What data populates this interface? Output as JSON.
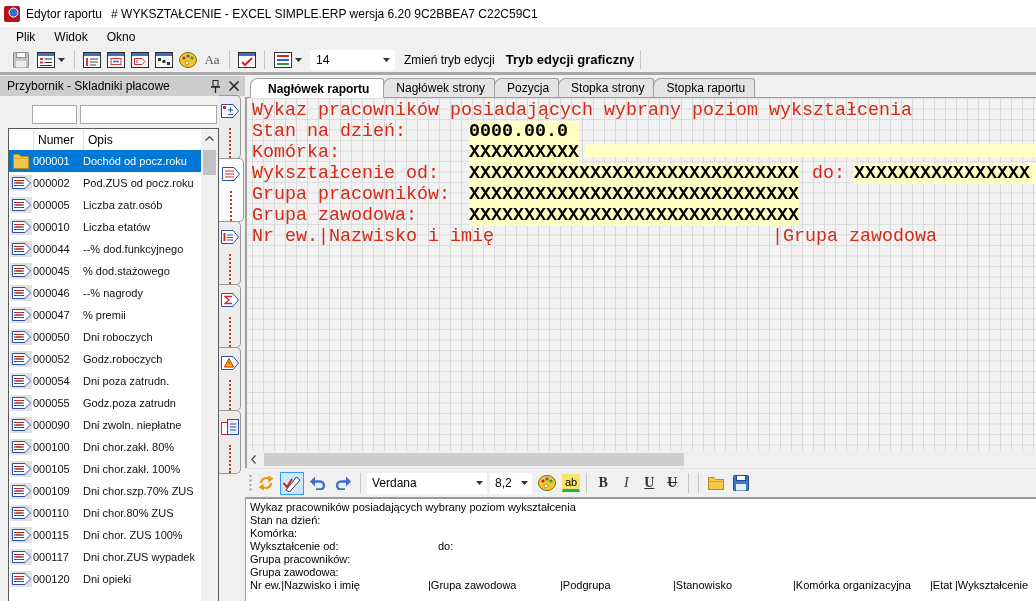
{
  "window": {
    "title": "Edytor raportu",
    "subtitle": "# WYKSZTAŁCENIE - EXCEL SIMPLE.ERP wersja 6.20 9C2BBEA7 C22C59C1"
  },
  "menu": [
    "Plik",
    "Widok",
    "Okno"
  ],
  "toolbar": {
    "save_disabled": true,
    "font_button": "Aa",
    "font_size": "14",
    "mode_button": "Zmień tryb edycji",
    "mode_label": "Tryb edycji graficzny"
  },
  "toolbox": {
    "title": "Przybornik - Skladniki płacowe",
    "columns": [
      "Numer",
      "Opis"
    ],
    "items": [
      {
        "number": "000001",
        "description": "Dochód od pocz.roku",
        "kind": "folder",
        "selected": true
      },
      {
        "number": "000002",
        "description": "Pod.ZUS od pocz.roku",
        "kind": "item",
        "selected": false
      },
      {
        "number": "000005",
        "description": "Liczba zatr.osób",
        "kind": "item",
        "selected": false
      },
      {
        "number": "000010",
        "description": "Liczba etatów",
        "kind": "item",
        "selected": false
      },
      {
        "number": "000044",
        "description": "--% dod.funkcyjnego",
        "kind": "item",
        "selected": false
      },
      {
        "number": "000045",
        "description": "% dod.stażowego",
        "kind": "item",
        "selected": false
      },
      {
        "number": "000046",
        "description": "--% nagrody",
        "kind": "item",
        "selected": false
      },
      {
        "number": "000047",
        "description": "% premii",
        "kind": "item",
        "selected": false
      },
      {
        "number": "000050",
        "description": "Dni roboczych",
        "kind": "item",
        "selected": false
      },
      {
        "number": "000052",
        "description": "Godz.roboczych",
        "kind": "item",
        "selected": false
      },
      {
        "number": "000054",
        "description": "Dni poza zatrudn.",
        "kind": "item",
        "selected": false
      },
      {
        "number": "000055",
        "description": "Godz.poza zatrudn",
        "kind": "item",
        "selected": false
      },
      {
        "number": "000090",
        "description": "Dni zwoln. niepłatne",
        "kind": "item",
        "selected": false
      },
      {
        "number": "000100",
        "description": "Dni chor.zakł. 80%",
        "kind": "item",
        "selected": false
      },
      {
        "number": "000105",
        "description": "Dni chor.zakł. 100%",
        "kind": "item",
        "selected": false
      },
      {
        "number": "000109",
        "description": "Dni chor.szp.70% ZUS",
        "kind": "item",
        "selected": false
      },
      {
        "number": "000110",
        "description": "Dni chor.80% ZUS",
        "kind": "item",
        "selected": false
      },
      {
        "number": "000115",
        "description": "Dni chor. ZUS 100%",
        "kind": "item",
        "selected": false
      },
      {
        "number": "000117",
        "description": "Dni chor.ZUS wypadek",
        "kind": "item",
        "selected": false
      },
      {
        "number": "000120",
        "description": "Dni opieki",
        "kind": "item",
        "selected": false
      }
    ]
  },
  "side_tabs": [
    {
      "selected": false
    },
    {
      "selected": true
    },
    {
      "selected": false
    },
    {
      "selected": false
    },
    {
      "selected": false
    },
    {
      "selected": false
    }
  ],
  "section_tabs": [
    {
      "label": "Nagłówek raportu",
      "selected": true
    },
    {
      "label": "Nagłówek strony",
      "selected": false
    },
    {
      "label": "Pozycja",
      "selected": false
    },
    {
      "label": "Stopka strony",
      "selected": false
    },
    {
      "label": "Stopka raportu",
      "selected": false
    }
  ],
  "report_header": {
    "title": "Wykaz pracowników posiadających wybrany poziom wykształcenia",
    "fields": [
      {
        "kind": "single",
        "label": "Stan na dzień:",
        "value": "0000.00.0"
      },
      {
        "kind": "wide",
        "label": "Komórka:",
        "value": "XXXXXXXXXX"
      },
      {
        "kind": "range",
        "label": "Wykształcenie od:",
        "value": "XXXXXXXXXXXXXXXXXXXXXXXXXXXXXX",
        "label_2": "do:",
        "value_2": "XXXXXXXXXXXXXXXX"
      },
      {
        "kind": "single",
        "label": "Grupa pracowników:",
        "value": "XXXXXXXXXXXXXXXXXXXXXXXXXXXXXX"
      },
      {
        "kind": "single",
        "label": "Grupa zawodowa:",
        "value": "XXXXXXXXXXXXXXXXXXXXXXXXXXXXXX"
      }
    ],
    "columns": [
      "Nr ew.|Nazwisko i imię",
      "|Grupa zawodowa"
    ]
  },
  "editor_toolbar": {
    "toggle_pressed": true,
    "font": "Verdana",
    "size": "8,2",
    "highlight_button": "ab",
    "format_buttons": [
      {
        "label": "B",
        "kind": "bold"
      },
      {
        "label": "I",
        "kind": "italic"
      },
      {
        "label": "U",
        "kind": "underline"
      },
      {
        "label": "U",
        "kind": "strike"
      }
    ]
  },
  "text_preview": {
    "lines": [
      [
        "Wykaz pracowników posiadających wybrany poziom wykształcenia"
      ],
      [
        "Stan na dzień:"
      ],
      [
        "Komórka:"
      ],
      [
        "Wykształcenie od:",
        "do:"
      ],
      [
        "Grupa pracowników:"
      ],
      [
        "Grupa zawodowa:"
      ],
      [
        "Nr ew.|Nazwisko i imię",
        "|Grupa zawodowa",
        "|Podgrupa",
        "|Stanowisko",
        "|Komórka organizacyjna",
        "|Etat",
        "|Wykształcenie"
      ]
    ]
  }
}
